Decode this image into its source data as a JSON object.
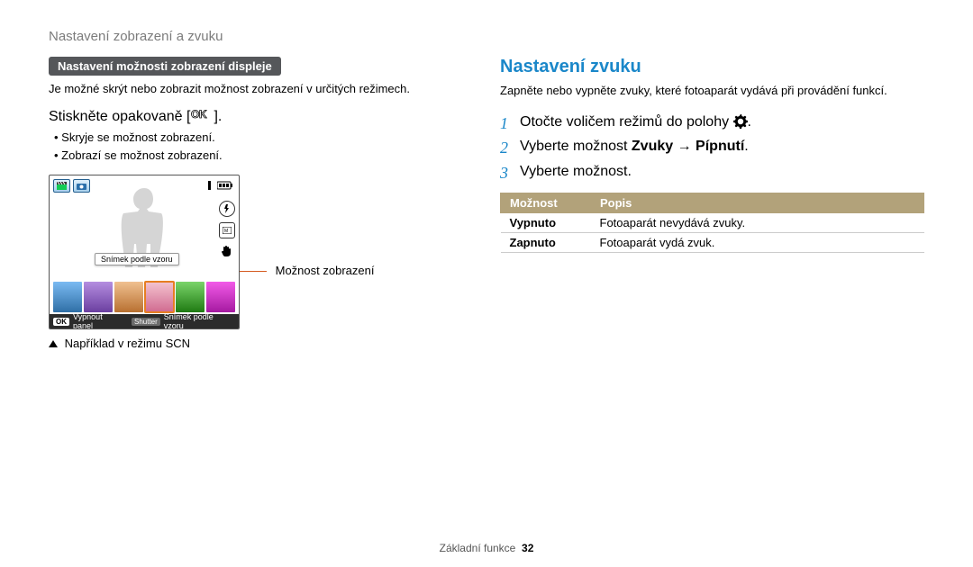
{
  "header": "Nastavení zobrazení a zvuku",
  "left": {
    "subheader": "Nastavení možnosti zobrazení displeje",
    "intro": "Je možné skrýt nebo zobrazit možnost zobrazení v určitých režimech.",
    "press_label_prefix": "Stiskněte opakovaně [",
    "press_label_suffix": "].",
    "bullets": [
      "Skryje se možnost zobrazení.",
      "Zobrazí se možnost zobrazení."
    ],
    "lcd": {
      "tooltip": "Snímek podle vzoru",
      "bottom_ok": "OK",
      "bottom_left": "Vypnout panel",
      "bottom_shutter": "Shutter",
      "bottom_right": "Snímek podle vzoru",
      "thumb_colors": [
        "#5aa6e6",
        "#8b5db5",
        "#e0a06a",
        "#e6a7b8",
        "#4a9f3d",
        "#d643c7"
      ]
    },
    "annotation": "Možnost zobrazení",
    "caption_prefix": "Například v režimu ",
    "caption_mode": "SCN"
  },
  "right": {
    "title": "Nastavení zvuku",
    "intro": "Zapněte nebo vypněte zvuky, které fotoaparát vydává při provádění funkcí.",
    "steps": {
      "s1_prefix": "Otočte voličem režimů do polohy ",
      "s1_suffix": ".",
      "s2_prefix": "Vyberte možnost ",
      "s2_bold1": "Zvuky",
      "s2_arrow": " → ",
      "s2_bold2": "Pípnutí",
      "s2_suffix": ".",
      "s3": "Vyberte možnost."
    },
    "table": {
      "h1": "Možnost",
      "h2": "Popis",
      "rows": [
        {
          "opt": "Vypnuto",
          "desc": "Fotoaparát nevydává zvuky."
        },
        {
          "opt": "Zapnuto",
          "desc": "Fotoaparát vydá zvuk."
        }
      ]
    }
  },
  "footer": {
    "section": "Základní funkce",
    "page": "32"
  }
}
